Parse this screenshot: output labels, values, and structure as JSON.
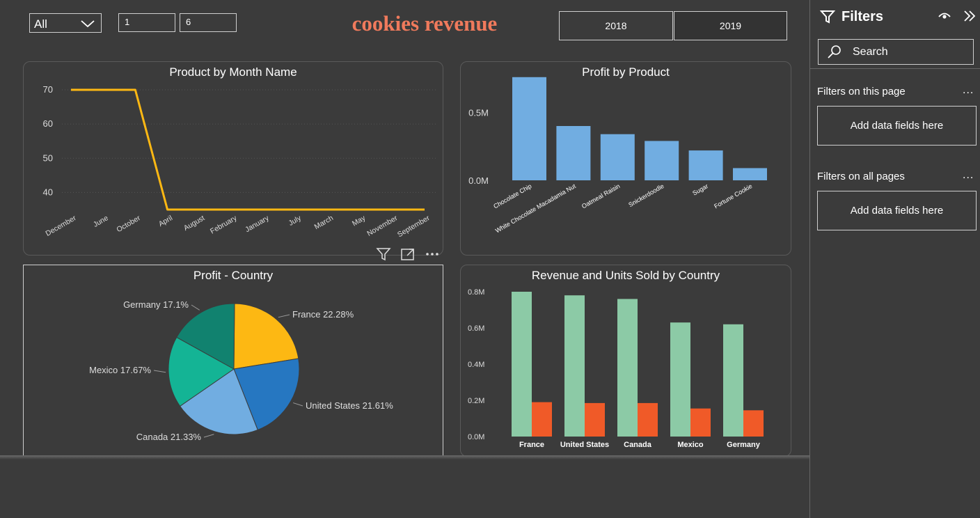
{
  "slicers": {
    "dropdown_value": "All",
    "range_start": "1",
    "range_end": "6",
    "year_options": [
      "2018",
      "2019"
    ]
  },
  "report_title": "cookies revenue",
  "visuals": {
    "line": {
      "title": "Product by Month Name"
    },
    "profit_product": {
      "title": "Profit by Product"
    },
    "pie": {
      "title": "Profit - Country"
    },
    "combo": {
      "title": "Revenue and Units Sold by Country"
    }
  },
  "chart_data": [
    {
      "type": "line",
      "title": "Product by Month Name",
      "categories": [
        "December",
        "June",
        "October",
        "April",
        "August",
        "February",
        "January",
        "July",
        "March",
        "May",
        "November",
        "September"
      ],
      "values": [
        70,
        70,
        70,
        35,
        35,
        35,
        35,
        35,
        35,
        35,
        35,
        35
      ],
      "yticks": [
        "70",
        "60",
        "50",
        "40"
      ],
      "ylim": [
        35,
        70
      ],
      "grid": true,
      "color": "#fdb813"
    },
    {
      "type": "bar",
      "title": "Profit by Product",
      "categories": [
        "Chocolate Chip",
        "White Chocolate Macadamia Nut",
        "Oatmeal Raisin",
        "Snickerdoodle",
        "Sugar",
        "Fortune Cookie"
      ],
      "values": [
        0.76,
        0.4,
        0.34,
        0.29,
        0.22,
        0.09
      ],
      "unit": "M",
      "yticks": [
        "0.5M",
        "0.0M"
      ],
      "ylim": [
        0,
        0.8
      ],
      "color": "#71ade1"
    },
    {
      "type": "pie",
      "title": "Profit - Country",
      "slices": [
        {
          "label": "France",
          "pct": 22.28,
          "text": "France 22.28%",
          "color": "#fdb813"
        },
        {
          "label": "United States",
          "pct": 21.61,
          "text": "United States 21.61%",
          "color": "#2677c1"
        },
        {
          "label": "Canada",
          "pct": 21.33,
          "text": "Canada 21.33%",
          "color": "#71ade1"
        },
        {
          "label": "Mexico",
          "pct": 17.67,
          "text": "Mexico 17.67%",
          "color": "#14b495"
        },
        {
          "label": "Germany",
          "pct": 17.1,
          "text": "Germany 17.1%",
          "color": "#11826f"
        }
      ]
    },
    {
      "type": "bar",
      "title": "Revenue and Units Sold by Country",
      "categories": [
        "France",
        "United States",
        "Canada",
        "Mexico",
        "Germany"
      ],
      "series": [
        {
          "values": [
            0.8,
            0.78,
            0.76,
            0.63,
            0.62
          ],
          "color": "#8ccaa6"
        },
        {
          "values": [
            0.19,
            0.185,
            0.185,
            0.155,
            0.145
          ],
          "color": "#f05a28"
        }
      ],
      "yticks": [
        "0.8M",
        "0.6M",
        "0.4M",
        "0.2M",
        "0.0M"
      ],
      "ylim": [
        0,
        0.8
      ]
    }
  ],
  "filters_pane": {
    "title": "Filters",
    "search_placeholder": "Search",
    "section_this_page": "Filters on this page",
    "section_all_pages": "Filters on all pages",
    "more_label": "...",
    "well_label": "Add data fields here"
  }
}
